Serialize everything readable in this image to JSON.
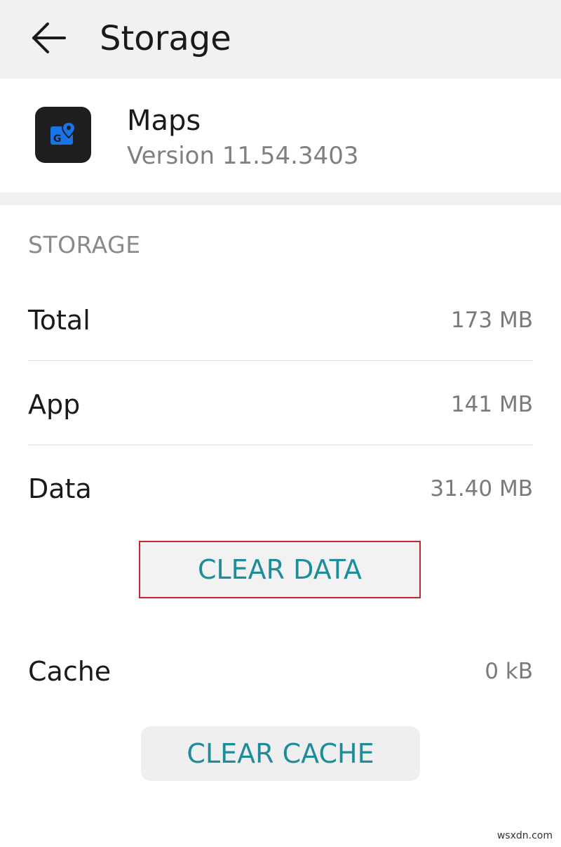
{
  "header": {
    "title": "Storage",
    "back_icon": "arrow-left-icon"
  },
  "app": {
    "name": "Maps",
    "version": "Version 11.54.3403",
    "icon": "maps-pin-icon",
    "icon_letter": "G"
  },
  "section": {
    "label": "STORAGE"
  },
  "rows": [
    {
      "label": "Total",
      "value": "173 MB"
    },
    {
      "label": "App",
      "value": "141 MB"
    },
    {
      "label": "Data",
      "value": "31.40 MB"
    },
    {
      "label": "Cache",
      "value": "0 kB"
    }
  ],
  "buttons": {
    "clear_data": "CLEAR DATA",
    "clear_cache": "CLEAR CACHE"
  },
  "watermark": "wsxdn.com",
  "colors": {
    "accent": "#1f8c9a",
    "highlight_border": "#c8262d",
    "icon_background": "#1f1f1f",
    "icon_blue": "#1a73e8"
  }
}
